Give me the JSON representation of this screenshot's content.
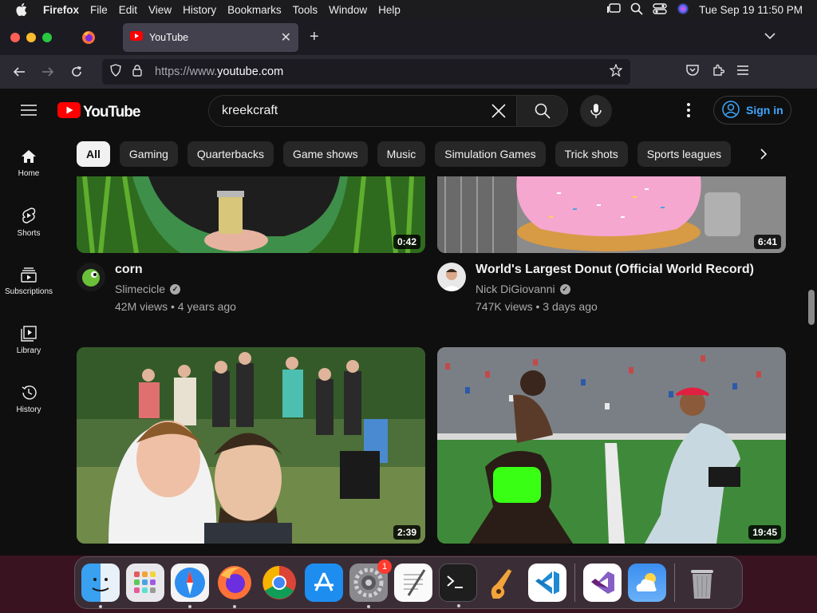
{
  "menubar": {
    "app_name": "Firefox",
    "items": [
      "File",
      "Edit",
      "View",
      "History",
      "Bookmarks",
      "Tools",
      "Window",
      "Help"
    ],
    "clock": "Tue Sep 19  11:50 PM"
  },
  "browser": {
    "tab_title": "YouTube",
    "url_scheme": "https://www.",
    "url_host": "youtube.com"
  },
  "youtube": {
    "logo_text": "YouTube",
    "search_value": "kreekcraft",
    "signin_label": "Sign in",
    "chips": [
      "All",
      "Gaming",
      "Quarterbacks",
      "Game shows",
      "Music",
      "Simulation Games",
      "Trick shots",
      "Sports leagues"
    ],
    "sidebar": [
      {
        "label": "Home",
        "icon": "home-icon"
      },
      {
        "label": "Shorts",
        "icon": "shorts-icon"
      },
      {
        "label": "Subscriptions",
        "icon": "subscriptions-icon"
      },
      {
        "label": "Library",
        "icon": "library-icon"
      },
      {
        "label": "History",
        "icon": "history-icon"
      }
    ],
    "videos": [
      {
        "title": "corn",
        "channel": "Slimecicle",
        "stats": "42M views • 4 years ago",
        "duration": "0:42"
      },
      {
        "title": "World's Largest Donut (Official World Record)",
        "channel": "Nick DiGiovanni",
        "stats": "747K views • 3 days ago",
        "duration": "6:41"
      },
      {
        "title": "",
        "channel": "",
        "stats": "",
        "duration": "2:39"
      },
      {
        "title": "",
        "channel": "",
        "stats": "",
        "duration": "19:45"
      }
    ]
  },
  "dock": {
    "items": [
      "finder-icon",
      "launchpad-icon",
      "safari-icon",
      "firefox-icon",
      "chrome-icon",
      "app-store-icon",
      "system-settings-icon",
      "textedit-icon",
      "terminal-icon",
      "garageband-icon",
      "vscode-icon",
      "visual-studio-icon",
      "weather-icon",
      "trash-icon"
    ],
    "settings_badge": "1"
  },
  "colors": {
    "yt_red": "#ff0000",
    "yt_bg": "#0f0f0f",
    "link_blue": "#3ea6ff"
  }
}
